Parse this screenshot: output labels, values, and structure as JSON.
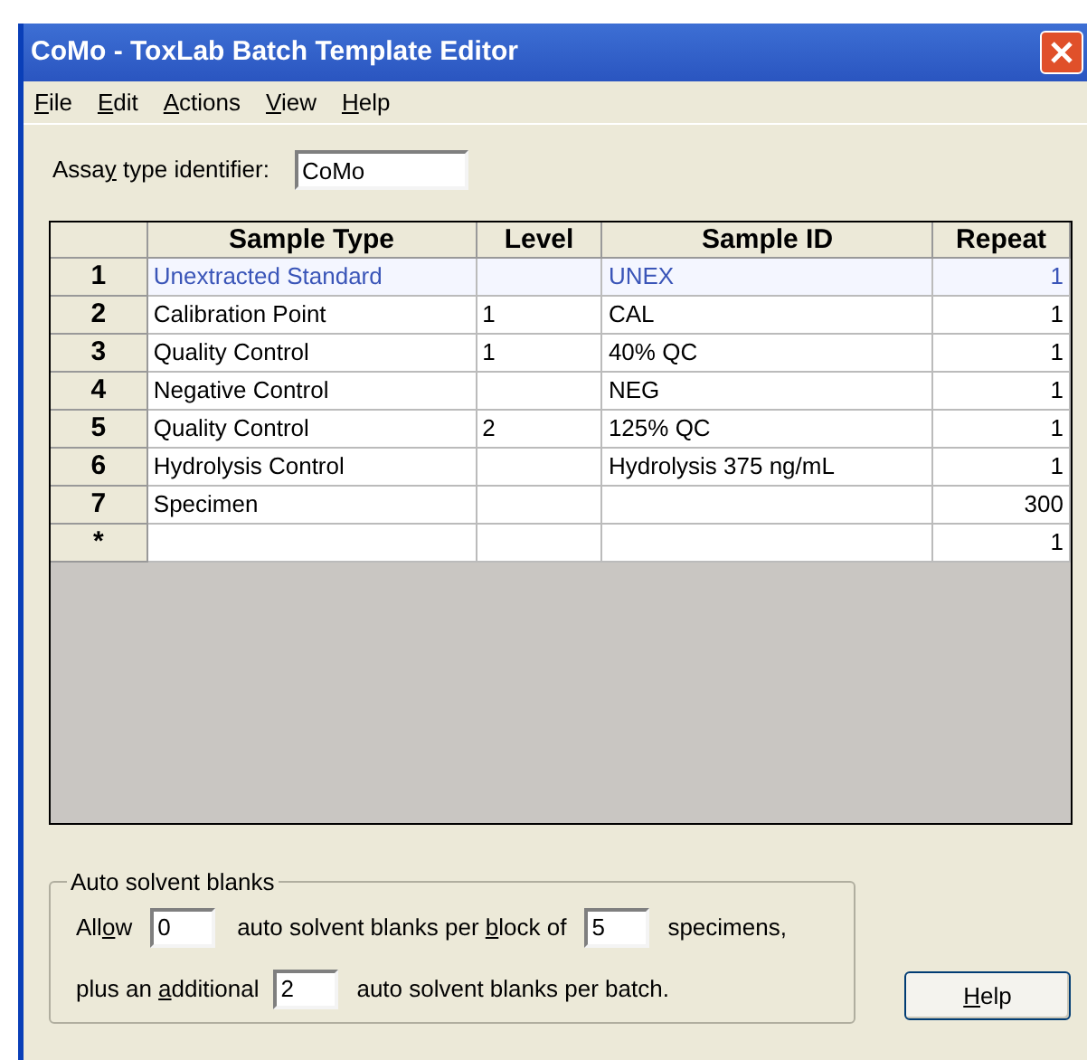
{
  "window": {
    "title": "CoMo - ToxLab Batch Template Editor"
  },
  "menu": [
    {
      "key": "F",
      "after": "ile"
    },
    {
      "key": "E",
      "after": "dit"
    },
    {
      "key": "A",
      "after": "ctions"
    },
    {
      "key": "V",
      "after": "iew"
    },
    {
      "key": "H",
      "after": "elp"
    }
  ],
  "assay": {
    "label": {
      "before": "Assa",
      "key": "y",
      "after": " type identifier:"
    },
    "value": "CoMo"
  },
  "table": {
    "columns": [
      "Sample Type",
      "Level",
      "Sample ID",
      "Repeat"
    ],
    "rows": [
      {
        "header": "1",
        "cells": [
          "Unextracted Standard",
          "",
          "UNEX",
          "1"
        ],
        "highlighted": true
      },
      {
        "header": "2",
        "cells": [
          "Calibration Point",
          "1",
          "CAL",
          "1"
        ],
        "highlighted": false
      },
      {
        "header": "3",
        "cells": [
          "Quality Control",
          "1",
          "40% QC",
          "1"
        ],
        "highlighted": false
      },
      {
        "header": "4",
        "cells": [
          "Negative Control",
          "",
          "NEG",
          "1"
        ],
        "highlighted": false
      },
      {
        "header": "5",
        "cells": [
          "Quality Control",
          "2",
          "125% QC",
          "1"
        ],
        "highlighted": false
      },
      {
        "header": "6",
        "cells": [
          "Hydrolysis Control",
          "",
          "Hydrolysis 375 ng/mL",
          "1"
        ],
        "highlighted": false
      },
      {
        "header": "7",
        "cells": [
          "Specimen",
          "",
          "",
          "300"
        ],
        "highlighted": false
      },
      {
        "header": "*",
        "cells": [
          "",
          "",
          "",
          "1"
        ],
        "highlighted": false
      }
    ]
  },
  "blanks": {
    "title": "Auto solvent blanks",
    "allow_label": {
      "before": "All",
      "key": "o",
      "after": "w"
    },
    "allow_value": "0",
    "per_block_label": {
      "before": "auto solvent blanks per ",
      "key": "b",
      "after": "lock of"
    },
    "block_value": "5",
    "specimens_label": "specimens,",
    "additional_label": {
      "before": "plus an ",
      "key": "a",
      "after": "dditional"
    },
    "additional_value": "2",
    "per_batch_label": "auto solvent blanks per batch."
  },
  "help_button": {
    "key": "H",
    "after": "elp"
  }
}
